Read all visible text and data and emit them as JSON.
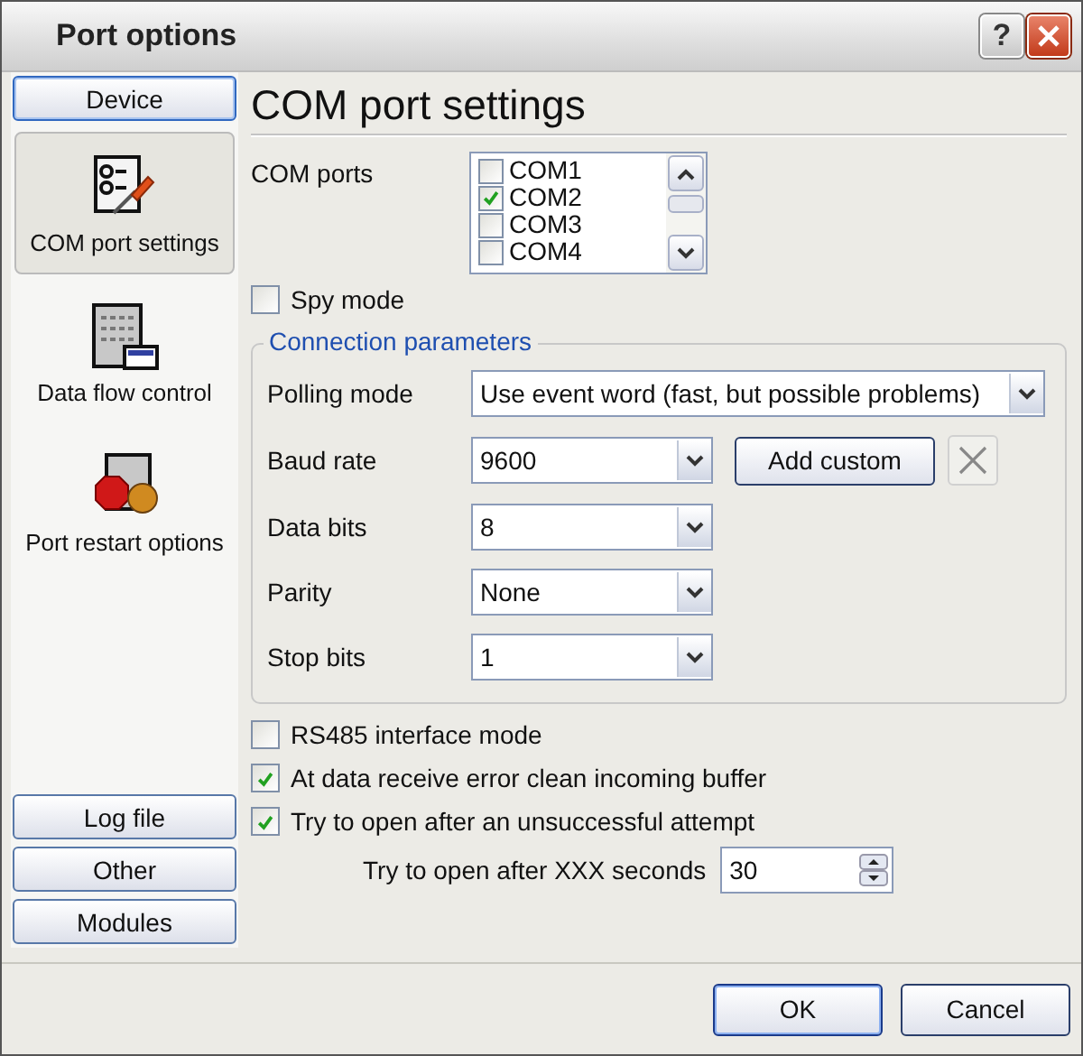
{
  "window": {
    "title": "Port options",
    "help": "?"
  },
  "sidebar": {
    "top_button": {
      "label": "Device",
      "selected": true
    },
    "items": [
      {
        "label": "COM port settings",
        "selected": true,
        "kind": "settings"
      },
      {
        "label": "Data flow control",
        "selected": false,
        "kind": "dataflow"
      },
      {
        "label": "Port restart options",
        "selected": false,
        "kind": "restart"
      }
    ],
    "bottom_buttons": [
      "Log file",
      "Other",
      "Modules"
    ]
  },
  "page": {
    "heading": "COM port settings",
    "com_ports": {
      "label": "COM ports",
      "items": [
        {
          "label": "COM1",
          "checked": false
        },
        {
          "label": "COM2",
          "checked": true
        },
        {
          "label": "COM3",
          "checked": false
        },
        {
          "label": "COM4",
          "checked": false
        }
      ]
    },
    "spy_mode": {
      "label": "Spy mode",
      "checked": false
    },
    "group": {
      "title": "Connection parameters",
      "fields": [
        {
          "label": "Polling mode",
          "value": "Use event word (fast, but possible problems)",
          "kind": "wide"
        },
        {
          "label": "Baud rate",
          "value": "9600",
          "kind": "custom",
          "button": "Add custom"
        },
        {
          "label": "Data bits",
          "value": "8",
          "kind": "plain"
        },
        {
          "label": "Parity",
          "value": "None",
          "kind": "plain"
        },
        {
          "label": "Stop bits",
          "value": "1",
          "kind": "plain"
        }
      ]
    },
    "options": [
      {
        "label": "RS485 interface mode",
        "checked": false
      },
      {
        "label": "At data receive error clean incoming buffer",
        "checked": true
      },
      {
        "label": "Try to open after an unsuccessful attempt",
        "checked": true
      }
    ],
    "retry": {
      "label": "Try to open after XXX seconds",
      "value": "30"
    }
  },
  "buttons": [
    "OK",
    "Cancel"
  ]
}
